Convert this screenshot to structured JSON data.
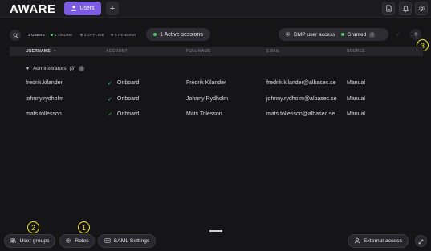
{
  "app": {
    "logo": "AWARE"
  },
  "tabs": {
    "users_label": "Users",
    "add_label": "+"
  },
  "filters": {
    "users": "3 USERS",
    "online": "1 ONLINE",
    "offline": "2 OFFLINE",
    "pending": "0 PENDING"
  },
  "sessions": {
    "label": "1 Active sessions"
  },
  "dmp": {
    "label": "DMP user access",
    "status": "Granted"
  },
  "table": {
    "columns": [
      "USERNAME",
      "ACCOUNT",
      "FULL NAME",
      "EMAIL",
      "SOURCE"
    ],
    "sort_indicator": "~",
    "group": {
      "name": "Administrators",
      "count": "(3)"
    },
    "rows": [
      {
        "username": "fredrik.kilander",
        "account": "Onboard",
        "full_name": "Fredrik Kilander",
        "email": "fredrik.kilander@albasec.se",
        "source": "Manual"
      },
      {
        "username": "johnny.rydholm",
        "account": "Onboard",
        "full_name": "Johnny Rydholm",
        "email": "johnny.rydholm@albasec.se",
        "source": "Manual"
      },
      {
        "username": "mats.tollesson",
        "account": "Onboard",
        "full_name": "Mats Tolesson",
        "email": "mats.tollesson@albasec.se",
        "source": "Manual"
      }
    ]
  },
  "footer": {
    "user_groups": "User groups",
    "roles": "Roles",
    "saml": "SAML Settings",
    "external_access": "External access"
  },
  "annotations": {
    "one": "1",
    "two": "2",
    "three": "3"
  },
  "colors": {
    "accent": "#7c5ce0",
    "online": "#4cc866",
    "annotation": "#f2e52c"
  },
  "icons": [
    "user-icon",
    "document-icon",
    "bell-icon",
    "gear-icon",
    "search-icon",
    "key-icon",
    "check-icon",
    "info-icon",
    "users-icon",
    "roles-icon",
    "saml-icon",
    "person-icon",
    "expand-icon",
    "plus-icon"
  ]
}
